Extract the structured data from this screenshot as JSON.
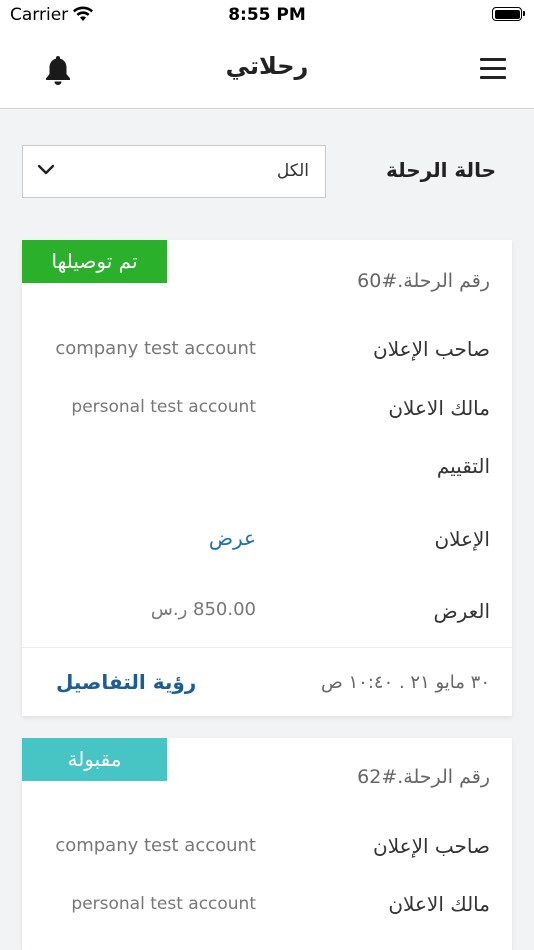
{
  "status_bar": {
    "carrier": "Carrier",
    "time": "8:55 PM"
  },
  "header": {
    "title": "رحلاتي"
  },
  "filter": {
    "label": "حالة الرحلة",
    "selected": "الكل"
  },
  "trips": [
    {
      "badge": "تم توصيلها",
      "badge_color": "#2bb02b",
      "trip_number": "رقم الرحلة.#60",
      "advertiser_label": "صاحب الإعلان",
      "advertiser_value": "company test account",
      "owner_label": "مالك الاعلان",
      "owner_value": "personal test account",
      "rating_label": "التقييم",
      "ad_label": "الإعلان",
      "ad_link": "عرض",
      "offer_label": "العرض",
      "offer_value": "850.00 ر.س",
      "date": "٣٠ مايو ٢١ . ١٠:٤٠ ص",
      "details_link": "رؤية التفاصيل"
    },
    {
      "badge": "مقبولة",
      "badge_color": "#47c4c4",
      "trip_number": "رقم الرحلة.#62",
      "advertiser_label": "صاحب الإعلان",
      "advertiser_value": "company test account",
      "owner_label": "مالك الاعلان",
      "owner_value": "personal test account"
    }
  ]
}
